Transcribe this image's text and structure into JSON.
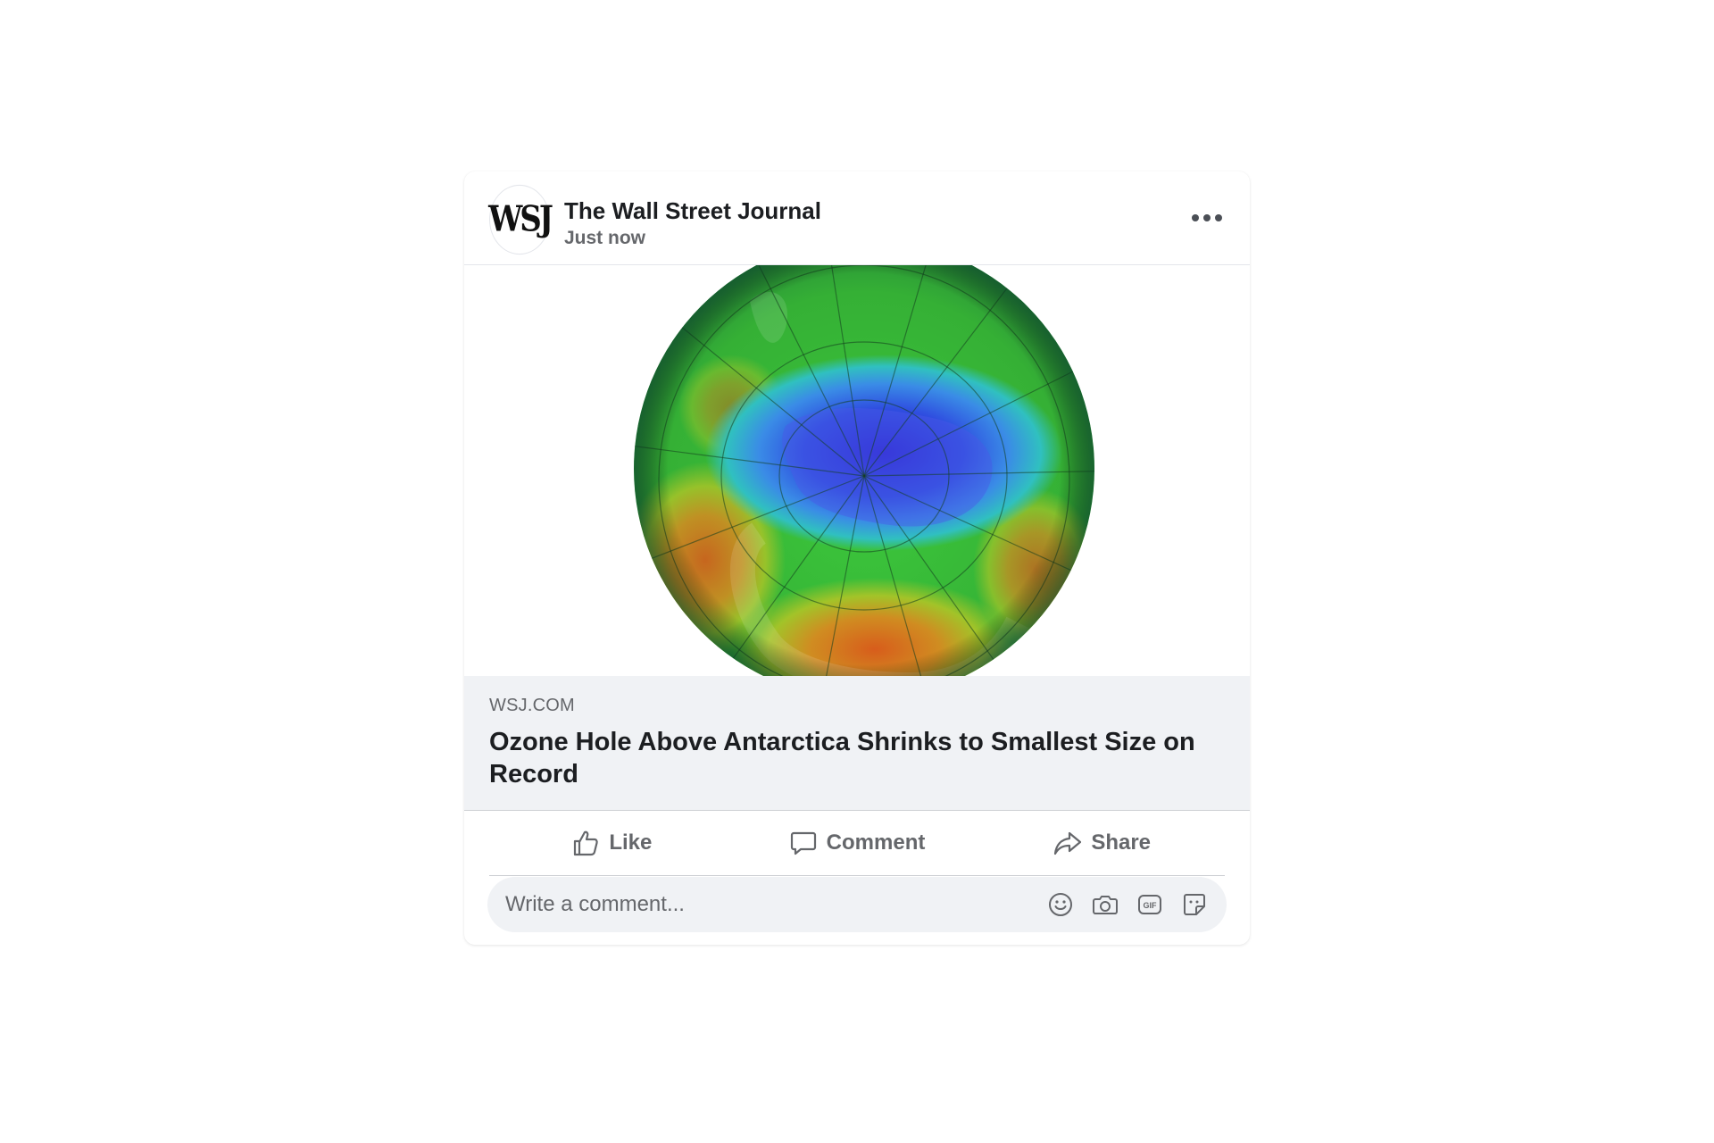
{
  "post": {
    "author": {
      "name": "The Wall Street Journal",
      "logo_text": "WSJ",
      "timestamp": "Just now"
    },
    "more_icon": "more-horizontal-icon",
    "image": {
      "subject": "ozone-map-globe",
      "colors": [
        "#1a2fd0",
        "#3a6ce8",
        "#2fb8c8",
        "#3cc83c",
        "#8ad02a",
        "#d8a020",
        "#d85a1a"
      ]
    },
    "link_preview": {
      "domain": "WSJ.COM",
      "title": "Ozone Hole Above Antarctica Shrinks to Smallest Size on Record"
    },
    "actions": [
      {
        "label": "Like",
        "icon": "thumbs-up-icon"
      },
      {
        "label": "Comment",
        "icon": "comment-icon"
      },
      {
        "label": "Share",
        "icon": "share-icon"
      }
    ],
    "comment": {
      "placeholder": "Write a comment...",
      "icons": [
        "emoji-icon",
        "camera-icon",
        "gif-icon",
        "sticker-icon"
      ]
    }
  }
}
